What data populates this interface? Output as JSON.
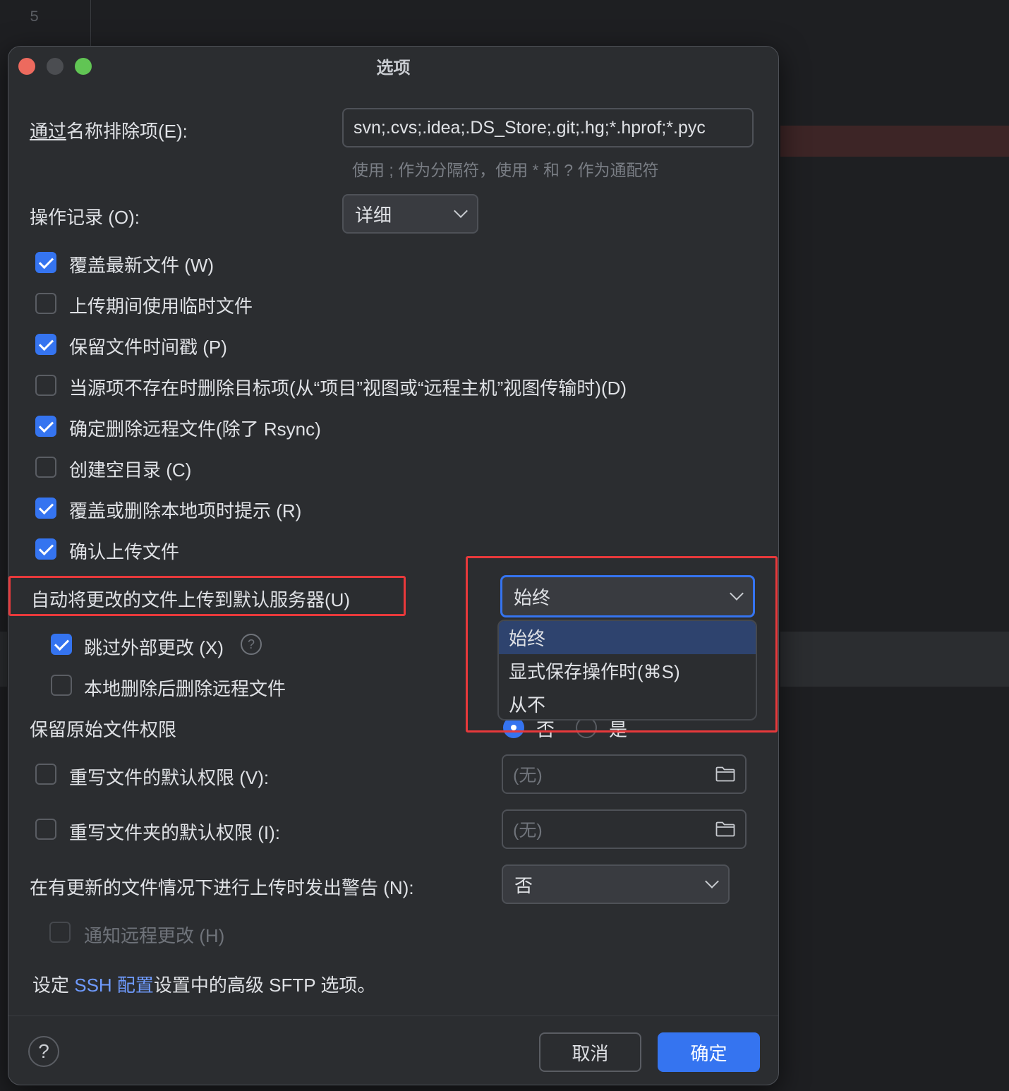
{
  "editor": {
    "line_number": "5"
  },
  "dialog": {
    "title": "选项",
    "exclude": {
      "label_underlined": "通过",
      "label_rest": "名称排除项(E):",
      "value": "svn;.cvs;.idea;.DS_Store;.git;.hg;*.hprof;*.pyc",
      "hint": "使用 ; 作为分隔符，使用 * 和 ? 作为通配符"
    },
    "log": {
      "label": "操作记录 (O):",
      "value": "详细"
    },
    "checkboxes": [
      {
        "label": "覆盖最新文件 (W)",
        "checked": true
      },
      {
        "label": "上传期间使用临时文件",
        "checked": false
      },
      {
        "label": "保留文件时间戳 (P)",
        "checked": true
      },
      {
        "label": "当源项不存在时删除目标项(从“项目”视图或“远程主机”视图传输时)(D)",
        "checked": false
      },
      {
        "label": "确定删除远程文件(除了 Rsync)",
        "checked": true
      },
      {
        "label": "创建空目录 (C)",
        "checked": false
      },
      {
        "label": "覆盖或删除本地项时提示 (R)",
        "checked": true
      },
      {
        "label": "确认上传文件",
        "checked": true
      }
    ],
    "auto_upload": {
      "label": "自动将更改的文件上传到默认服务器(U)",
      "value": "始终",
      "options": [
        "始终",
        "显式保存操作时(⌘S)",
        "从不"
      ],
      "selected_option": "始终"
    },
    "skip_external": {
      "label": "跳过外部更改 (X)",
      "checked": true,
      "help": "?"
    },
    "delete_remote_after_local": {
      "label": "本地删除后删除远程文件",
      "checked": false
    },
    "preserve_permissions": {
      "label": "保留原始文件权限",
      "option_no": "否",
      "option_yes": "是",
      "selected": "否"
    },
    "file_perm": {
      "label": "重写文件的默认权限 (V):",
      "checked": false,
      "placeholder": "(无)"
    },
    "folder_perm": {
      "label": "重写文件夹的默认权限 (I):",
      "checked": false,
      "placeholder": "(无)"
    },
    "warn_update": {
      "label": "在有更新的文件情况下进行上传时发出警告 (N):",
      "value": "否"
    },
    "notify_remote": {
      "label": "通知远程更改 (H)",
      "checked": false,
      "disabled": true
    },
    "ssh_note": {
      "prefix": "设定 ",
      "link": "SSH 配置",
      "suffix": "设置中的高级 SFTP 选项。"
    },
    "buttons": {
      "cancel": "取消",
      "ok": "确定",
      "help": "?"
    }
  },
  "colors": {
    "accent": "#3574f0",
    "highlight_box": "#e8393b",
    "dialog_bg": "#2b2d30"
  },
  "icons": [
    "folder-icon",
    "help-icon",
    "chevron-down-icon",
    "check-icon"
  ]
}
